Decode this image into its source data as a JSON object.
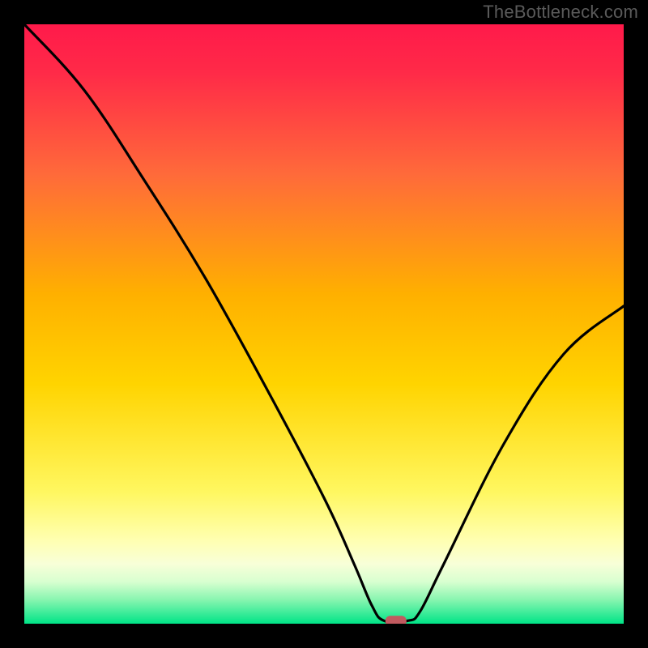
{
  "attribution": "TheBottleneck.com",
  "chart_data": {
    "type": "line",
    "title": "",
    "xlabel": "",
    "ylabel": "",
    "xlim": [
      0,
      100
    ],
    "ylim": [
      0,
      100
    ],
    "curve": [
      {
        "x": 0,
        "y": 100
      },
      {
        "x": 10,
        "y": 89
      },
      {
        "x": 20,
        "y": 74
      },
      {
        "x": 30,
        "y": 58
      },
      {
        "x": 40,
        "y": 40
      },
      {
        "x": 50,
        "y": 21
      },
      {
        "x": 55,
        "y": 10
      },
      {
        "x": 58,
        "y": 3
      },
      {
        "x": 60,
        "y": 0.5
      },
      {
        "x": 64,
        "y": 0.5
      },
      {
        "x": 66,
        "y": 2
      },
      {
        "x": 70,
        "y": 10
      },
      {
        "x": 80,
        "y": 30
      },
      {
        "x": 90,
        "y": 45
      },
      {
        "x": 100,
        "y": 53
      }
    ],
    "marker": {
      "x": 62,
      "y": 0.5,
      "color": "#c15a5f"
    },
    "background_gradient": {
      "top": "#ff1a4a",
      "mid": "#ffd400",
      "bottom": "#00e487"
    }
  }
}
